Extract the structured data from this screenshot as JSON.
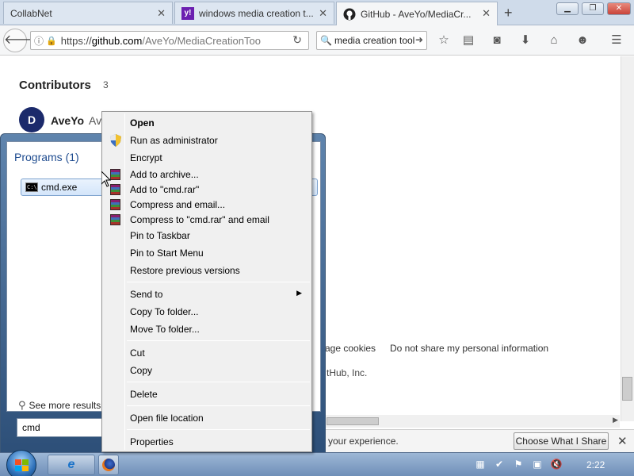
{
  "browser": {
    "tabs": [
      {
        "label": "CollabNet",
        "active": false
      },
      {
        "label": "windows media creation t...",
        "active": false
      },
      {
        "label": "GitHub - AveYo/MediaCr...",
        "active": true
      }
    ],
    "url": {
      "scheme": "https://",
      "domain": "github.com",
      "path": "/AveYo/MediaCreationToo"
    },
    "search_text": "media creation tool"
  },
  "page": {
    "contributors_title": "Contributors",
    "contributors_count": "3",
    "avatar_letter": "D",
    "contributor_name": "AveYo",
    "contributor_rest": "Av",
    "footer_links": [
      "age cookies",
      "Do not share my personal information"
    ],
    "footer_copy": "tHub, Inc."
  },
  "notification": {
    "text": "your experience.",
    "button_label": "Choose What I Share"
  },
  "start_menu": {
    "programs_header": "Programs (1)",
    "program_item": "cmd.exe",
    "see_more": "See more results",
    "search_value": "cmd"
  },
  "context_menu": {
    "items": [
      {
        "label": "Open",
        "bold": true,
        "icon": ""
      },
      {
        "label": "Run as administrator",
        "icon": "shield-icon"
      },
      {
        "label": "Encrypt",
        "icon": ""
      },
      {
        "label": "Add to archive...",
        "icon": "winrar-icon"
      },
      {
        "label": "Add to \"cmd.rar\"",
        "icon": "winrar-icon"
      },
      {
        "label": "Compress and email...",
        "icon": "winrar-icon"
      },
      {
        "label": "Compress to \"cmd.rar\" and email",
        "icon": "winrar-icon"
      },
      {
        "label": "Pin to Taskbar",
        "icon": ""
      },
      {
        "label": "Pin to Start Menu",
        "icon": ""
      },
      {
        "label": "Restore previous versions",
        "icon": ""
      },
      {
        "label": "Send to",
        "icon": "",
        "submenu": true
      },
      {
        "label": "Copy To folder...",
        "icon": ""
      },
      {
        "label": "Move To folder...",
        "icon": ""
      },
      {
        "label": "Cut",
        "icon": ""
      },
      {
        "label": "Copy",
        "icon": ""
      },
      {
        "label": "Delete",
        "icon": ""
      },
      {
        "label": "Open file location",
        "icon": ""
      },
      {
        "label": "Properties",
        "icon": ""
      }
    ]
  },
  "taskbar": {
    "clock": "2:22"
  }
}
